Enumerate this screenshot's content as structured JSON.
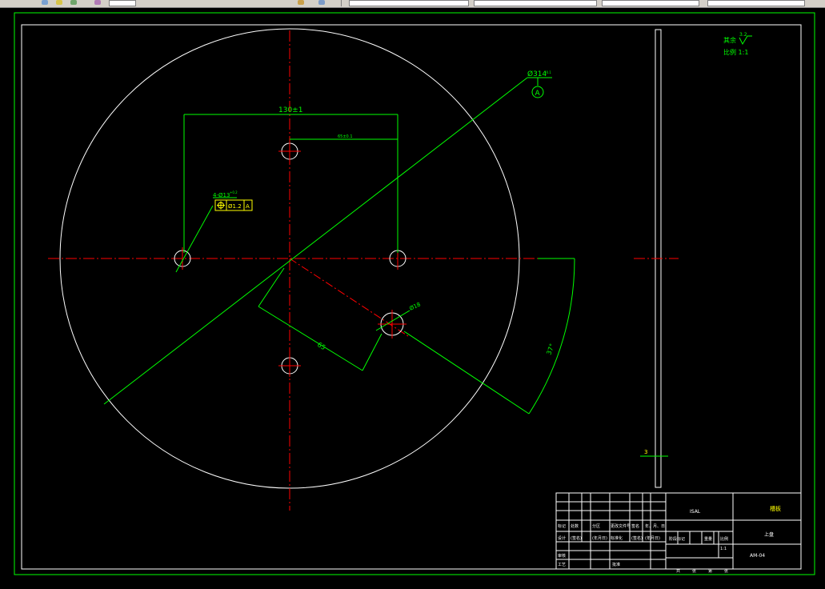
{
  "colors": {
    "background": "#000000",
    "outline": "#ffffff",
    "centerline": "#ff0000",
    "dimension": "#00ff00",
    "annotation_text": "#ffff00",
    "border": "#00ff00"
  },
  "toolbar": {
    "icons": [
      "layer-icon",
      "color-icon",
      "properties-icon",
      "match-icon",
      "zoom-icon"
    ]
  },
  "drawing": {
    "dims": {
      "bolt_spacing": "130±1",
      "inner_offset": "65±0.1",
      "hole_callout": "4-Ø13",
      "hole_callout_sup": "+0.2",
      "position_tol": "Ø1.2",
      "position_datum": "A",
      "outer_diameter": "Ø314",
      "outer_diameter_tol": "-0.1",
      "datum_label": "A",
      "hole_diameter": "Ø18",
      "radial_offset": "65",
      "angle": "37°",
      "thickness": "3"
    },
    "notes": {
      "roughness_prefix": "其余",
      "roughness_value": "3.2",
      "scale_label": "比例 1:1"
    }
  },
  "title_block": {
    "material": "ISAL",
    "part_name": "槽板",
    "unit": "上盘",
    "drawing_number": "AM-04",
    "scale": "1:1",
    "header_row": [
      "标记",
      "处数",
      "分区",
      "更改文件号",
      "签名",
      "年、月、日"
    ],
    "design_row": [
      "设计",
      "(签名)",
      "(年月日)",
      "标准化",
      "(签名)",
      "(年月日)"
    ],
    "stage_row": [
      "阶段标记",
      "重量",
      "比例"
    ],
    "review_row": [
      "审核",
      "",
      ""
    ],
    "process_row": [
      "工艺",
      "",
      "批准"
    ],
    "sheet_row": [
      "共",
      "张",
      "第",
      "张"
    ]
  }
}
